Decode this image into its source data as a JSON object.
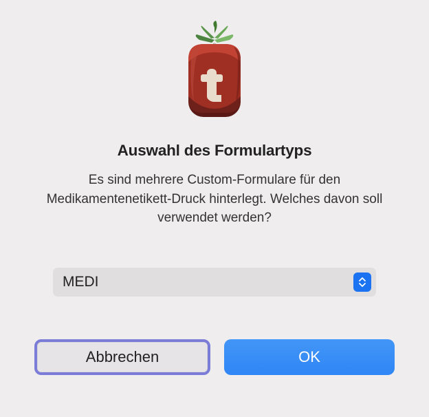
{
  "dialog": {
    "title": "Auswahl des Formulartyps",
    "description": "Es sind mehrere Custom-Formulare für den Medikamentenetikett-Druck hinterlegt. Welches davon soll verwendet werden?",
    "select": {
      "value": "MEDI"
    },
    "buttons": {
      "cancel": "Abbrechen",
      "ok": "OK"
    }
  }
}
